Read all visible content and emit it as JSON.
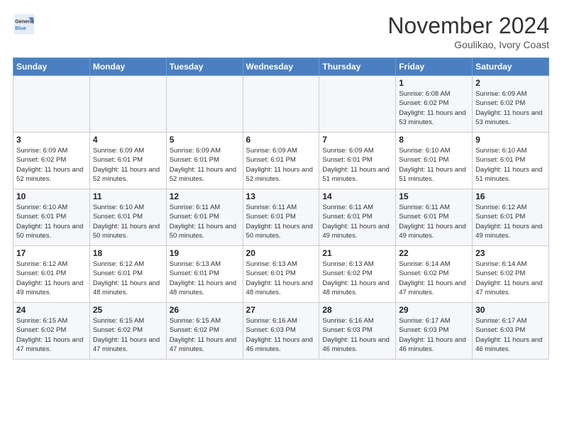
{
  "header": {
    "logo_line1": "General",
    "logo_line2": "Blue",
    "month_title": "November 2024",
    "location": "Goulikao, Ivory Coast"
  },
  "weekdays": [
    "Sunday",
    "Monday",
    "Tuesday",
    "Wednesday",
    "Thursday",
    "Friday",
    "Saturday"
  ],
  "weeks": [
    [
      {
        "day": "",
        "sunrise": "",
        "sunset": "",
        "daylight": ""
      },
      {
        "day": "",
        "sunrise": "",
        "sunset": "",
        "daylight": ""
      },
      {
        "day": "",
        "sunrise": "",
        "sunset": "",
        "daylight": ""
      },
      {
        "day": "",
        "sunrise": "",
        "sunset": "",
        "daylight": ""
      },
      {
        "day": "",
        "sunrise": "",
        "sunset": "",
        "daylight": ""
      },
      {
        "day": "1",
        "sunrise": "Sunrise: 6:08 AM",
        "sunset": "Sunset: 6:02 PM",
        "daylight": "Daylight: 11 hours and 53 minutes."
      },
      {
        "day": "2",
        "sunrise": "Sunrise: 6:09 AM",
        "sunset": "Sunset: 6:02 PM",
        "daylight": "Daylight: 11 hours and 53 minutes."
      }
    ],
    [
      {
        "day": "3",
        "sunrise": "Sunrise: 6:09 AM",
        "sunset": "Sunset: 6:02 PM",
        "daylight": "Daylight: 11 hours and 52 minutes."
      },
      {
        "day": "4",
        "sunrise": "Sunrise: 6:09 AM",
        "sunset": "Sunset: 6:01 PM",
        "daylight": "Daylight: 11 hours and 52 minutes."
      },
      {
        "day": "5",
        "sunrise": "Sunrise: 6:09 AM",
        "sunset": "Sunset: 6:01 PM",
        "daylight": "Daylight: 11 hours and 52 minutes."
      },
      {
        "day": "6",
        "sunrise": "Sunrise: 6:09 AM",
        "sunset": "Sunset: 6:01 PM",
        "daylight": "Daylight: 11 hours and 52 minutes."
      },
      {
        "day": "7",
        "sunrise": "Sunrise: 6:09 AM",
        "sunset": "Sunset: 6:01 PM",
        "daylight": "Daylight: 11 hours and 51 minutes."
      },
      {
        "day": "8",
        "sunrise": "Sunrise: 6:10 AM",
        "sunset": "Sunset: 6:01 PM",
        "daylight": "Daylight: 11 hours and 51 minutes."
      },
      {
        "day": "9",
        "sunrise": "Sunrise: 6:10 AM",
        "sunset": "Sunset: 6:01 PM",
        "daylight": "Daylight: 11 hours and 51 minutes."
      }
    ],
    [
      {
        "day": "10",
        "sunrise": "Sunrise: 6:10 AM",
        "sunset": "Sunset: 6:01 PM",
        "daylight": "Daylight: 11 hours and 50 minutes."
      },
      {
        "day": "11",
        "sunrise": "Sunrise: 6:10 AM",
        "sunset": "Sunset: 6:01 PM",
        "daylight": "Daylight: 11 hours and 50 minutes."
      },
      {
        "day": "12",
        "sunrise": "Sunrise: 6:11 AM",
        "sunset": "Sunset: 6:01 PM",
        "daylight": "Daylight: 11 hours and 50 minutes."
      },
      {
        "day": "13",
        "sunrise": "Sunrise: 6:11 AM",
        "sunset": "Sunset: 6:01 PM",
        "daylight": "Daylight: 11 hours and 50 minutes."
      },
      {
        "day": "14",
        "sunrise": "Sunrise: 6:11 AM",
        "sunset": "Sunset: 6:01 PM",
        "daylight": "Daylight: 11 hours and 49 minutes."
      },
      {
        "day": "15",
        "sunrise": "Sunrise: 6:11 AM",
        "sunset": "Sunset: 6:01 PM",
        "daylight": "Daylight: 11 hours and 49 minutes."
      },
      {
        "day": "16",
        "sunrise": "Sunrise: 6:12 AM",
        "sunset": "Sunset: 6:01 PM",
        "daylight": "Daylight: 11 hours and 49 minutes."
      }
    ],
    [
      {
        "day": "17",
        "sunrise": "Sunrise: 6:12 AM",
        "sunset": "Sunset: 6:01 PM",
        "daylight": "Daylight: 11 hours and 49 minutes."
      },
      {
        "day": "18",
        "sunrise": "Sunrise: 6:12 AM",
        "sunset": "Sunset: 6:01 PM",
        "daylight": "Daylight: 11 hours and 48 minutes."
      },
      {
        "day": "19",
        "sunrise": "Sunrise: 6:13 AM",
        "sunset": "Sunset: 6:01 PM",
        "daylight": "Daylight: 11 hours and 48 minutes."
      },
      {
        "day": "20",
        "sunrise": "Sunrise: 6:13 AM",
        "sunset": "Sunset: 6:01 PM",
        "daylight": "Daylight: 11 hours and 48 minutes."
      },
      {
        "day": "21",
        "sunrise": "Sunrise: 6:13 AM",
        "sunset": "Sunset: 6:02 PM",
        "daylight": "Daylight: 11 hours and 48 minutes."
      },
      {
        "day": "22",
        "sunrise": "Sunrise: 6:14 AM",
        "sunset": "Sunset: 6:02 PM",
        "daylight": "Daylight: 11 hours and 47 minutes."
      },
      {
        "day": "23",
        "sunrise": "Sunrise: 6:14 AM",
        "sunset": "Sunset: 6:02 PM",
        "daylight": "Daylight: 11 hours and 47 minutes."
      }
    ],
    [
      {
        "day": "24",
        "sunrise": "Sunrise: 6:15 AM",
        "sunset": "Sunset: 6:02 PM",
        "daylight": "Daylight: 11 hours and 47 minutes."
      },
      {
        "day": "25",
        "sunrise": "Sunrise: 6:15 AM",
        "sunset": "Sunset: 6:02 PM",
        "daylight": "Daylight: 11 hours and 47 minutes."
      },
      {
        "day": "26",
        "sunrise": "Sunrise: 6:15 AM",
        "sunset": "Sunset: 6:02 PM",
        "daylight": "Daylight: 11 hours and 47 minutes."
      },
      {
        "day": "27",
        "sunrise": "Sunrise: 6:16 AM",
        "sunset": "Sunset: 6:03 PM",
        "daylight": "Daylight: 11 hours and 46 minutes."
      },
      {
        "day": "28",
        "sunrise": "Sunrise: 6:16 AM",
        "sunset": "Sunset: 6:03 PM",
        "daylight": "Daylight: 11 hours and 46 minutes."
      },
      {
        "day": "29",
        "sunrise": "Sunrise: 6:17 AM",
        "sunset": "Sunset: 6:03 PM",
        "daylight": "Daylight: 11 hours and 46 minutes."
      },
      {
        "day": "30",
        "sunrise": "Sunrise: 6:17 AM",
        "sunset": "Sunset: 6:03 PM",
        "daylight": "Daylight: 11 hours and 46 minutes."
      }
    ]
  ]
}
